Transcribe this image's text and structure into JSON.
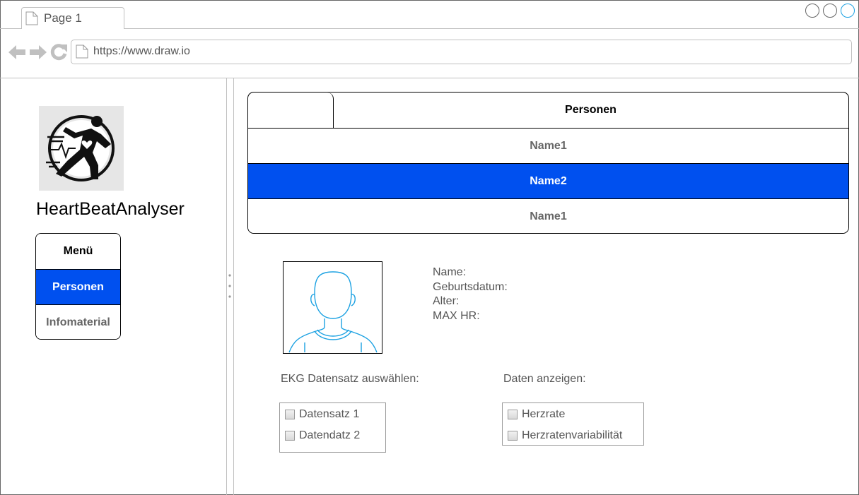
{
  "browser": {
    "tab_label": "Page 1",
    "url": "https://www.draw.io"
  },
  "sidebar": {
    "app_title": "HeartBeatAnalyser",
    "menu": {
      "header": "Menü",
      "items": [
        {
          "label": "Personen",
          "selected": true
        },
        {
          "label": "Infomaterial",
          "selected": false
        }
      ]
    }
  },
  "persons_table": {
    "header": "Personen",
    "rows": [
      {
        "label": "Name1",
        "selected": false
      },
      {
        "label": "Name2",
        "selected": true
      },
      {
        "label": "Name1",
        "selected": false
      }
    ]
  },
  "profile": {
    "fields": [
      "Name:",
      "Geburtsdatum:",
      "Alter:",
      "MAX HR:"
    ]
  },
  "ekg": {
    "label": "EKG Datensatz auswählen:",
    "options": [
      "Datensatz 1",
      "Datendatz 2"
    ]
  },
  "display": {
    "label": "Daten anzeigen:",
    "options": [
      "Herzrate",
      "Herzratenvariabilität"
    ]
  },
  "colors": {
    "accent": "#0050ef",
    "muted_text": "#666666"
  }
}
